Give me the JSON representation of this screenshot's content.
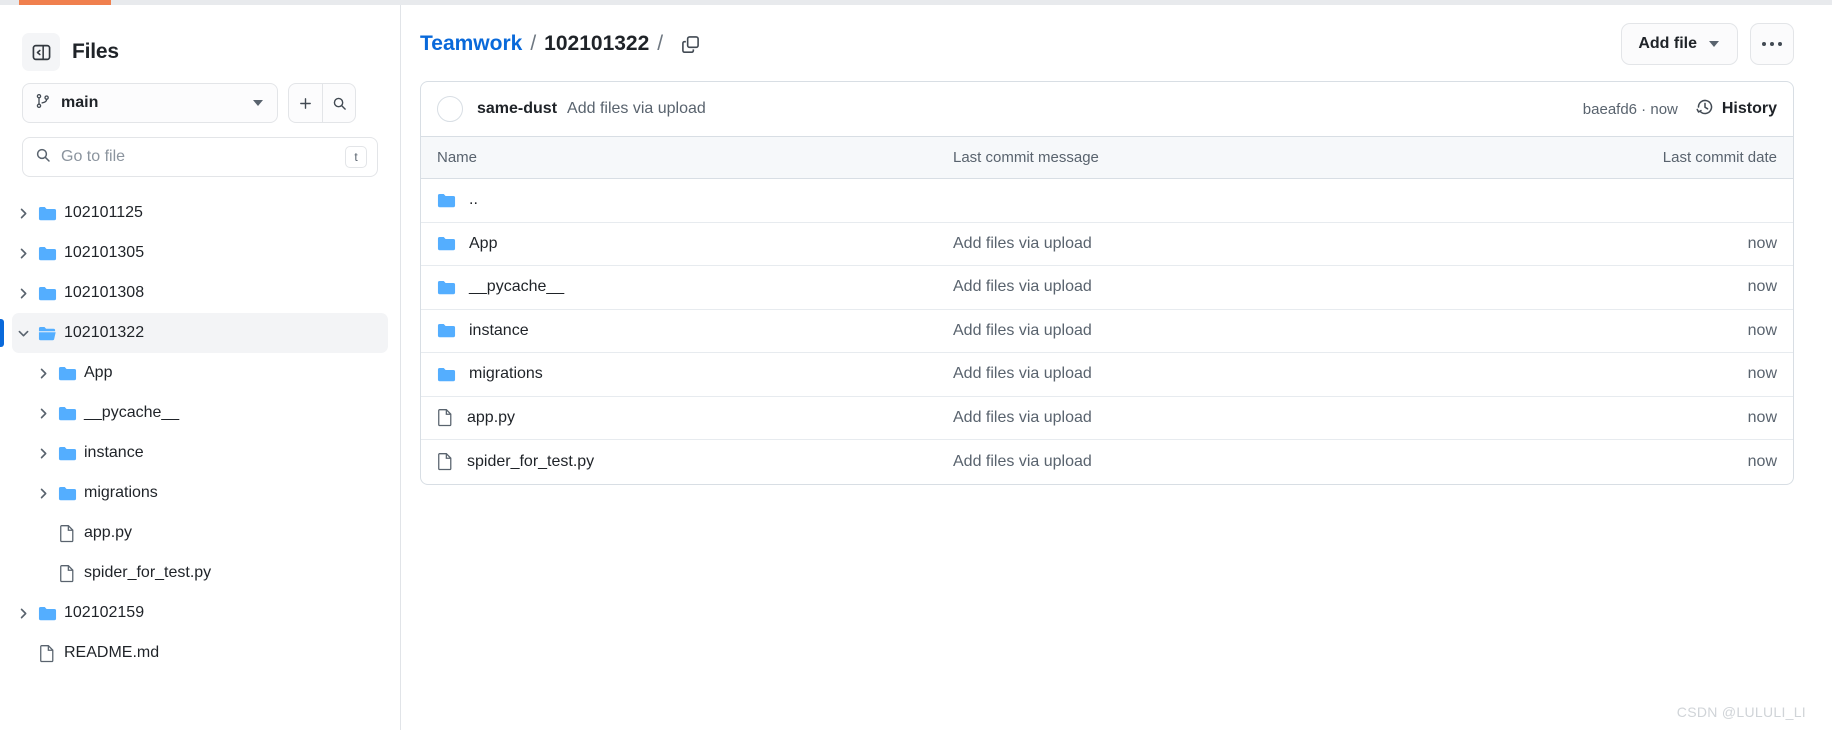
{
  "sidebar": {
    "toggle_icon": "sidebar-collapse-icon",
    "title": "Files",
    "branch": {
      "icon": "git-branch-icon",
      "name": "main",
      "caret_icon": "chevron-down-icon"
    },
    "add_button_icon": "plus-icon",
    "search_button_icon": "search-icon",
    "file_search": {
      "icon": "search-icon",
      "value": "",
      "placeholder": "Go to file",
      "shortcut": "t"
    },
    "tree": [
      {
        "chevron": "chevron-right-icon",
        "icon": "folder-icon",
        "label": "102101125",
        "depth": 0,
        "type": "folder",
        "selected": false,
        "expanded": false
      },
      {
        "chevron": "chevron-right-icon",
        "icon": "folder-icon",
        "label": "102101305",
        "depth": 0,
        "type": "folder",
        "selected": false,
        "expanded": false
      },
      {
        "chevron": "chevron-right-icon",
        "icon": "folder-icon",
        "label": "102101308",
        "depth": 0,
        "type": "folder",
        "selected": false,
        "expanded": false
      },
      {
        "chevron": "chevron-down-icon",
        "icon": "folder-open-icon",
        "label": "102101322",
        "depth": 0,
        "type": "folder",
        "selected": true,
        "expanded": true
      },
      {
        "chevron": "chevron-right-icon",
        "icon": "folder-icon",
        "label": "App",
        "depth": 1,
        "type": "folder",
        "selected": false,
        "expanded": false
      },
      {
        "chevron": "chevron-right-icon",
        "icon": "folder-icon",
        "label": "__pycache__",
        "depth": 1,
        "type": "folder",
        "selected": false,
        "expanded": false
      },
      {
        "chevron": "chevron-right-icon",
        "icon": "folder-icon",
        "label": "instance",
        "depth": 1,
        "type": "folder",
        "selected": false,
        "expanded": false
      },
      {
        "chevron": "chevron-right-icon",
        "icon": "folder-icon",
        "label": "migrations",
        "depth": 1,
        "type": "folder",
        "selected": false,
        "expanded": false
      },
      {
        "chevron": "",
        "icon": "file-icon",
        "label": "app.py",
        "depth": 1,
        "type": "file",
        "selected": false,
        "expanded": false
      },
      {
        "chevron": "",
        "icon": "file-icon",
        "label": "spider_for_test.py",
        "depth": 1,
        "type": "file",
        "selected": false,
        "expanded": false
      },
      {
        "chevron": "chevron-right-icon",
        "icon": "folder-icon",
        "label": "102102159",
        "depth": 0,
        "type": "folder",
        "selected": false,
        "expanded": false
      },
      {
        "chevron": "",
        "icon": "file-icon",
        "label": "README.md",
        "depth": 0,
        "type": "file",
        "selected": false,
        "expanded": false
      }
    ]
  },
  "header": {
    "breadcrumb": {
      "repo": "Teamwork",
      "sep1": "/",
      "current": "102101322",
      "sep2": "/",
      "copy_icon": "copy-path-icon"
    },
    "add_file_label": "Add file",
    "add_file_caret_icon": "chevron-down-icon",
    "more_button_icon": "kebab-menu-icon"
  },
  "commit_bar": {
    "avatar_icon": "avatar",
    "author": "same-dust",
    "message": "Add files via upload",
    "sha_and_time": "baeafd6 · now",
    "history_icon": "history-clock-icon",
    "history_label": "History"
  },
  "file_table": {
    "columns": {
      "name": "Name",
      "message": "Last commit message",
      "date": "Last commit date"
    },
    "rows": [
      {
        "icon": "folder-icon",
        "name": "..",
        "message": "",
        "date": "",
        "type": "folder"
      },
      {
        "icon": "folder-icon",
        "name": "App",
        "message": "Add files via upload",
        "date": "now",
        "type": "folder"
      },
      {
        "icon": "folder-icon",
        "name": "__pycache__",
        "message": "Add files via upload",
        "date": "now",
        "type": "folder"
      },
      {
        "icon": "folder-icon",
        "name": "instance",
        "message": "Add files via upload",
        "date": "now",
        "type": "folder"
      },
      {
        "icon": "folder-icon",
        "name": "migrations",
        "message": "Add files via upload",
        "date": "now",
        "type": "folder"
      },
      {
        "icon": "file-icon",
        "name": "app.py",
        "message": "Add files via upload",
        "date": "now",
        "type": "file"
      },
      {
        "icon": "file-icon",
        "name": "spider_for_test.py",
        "message": "Add files via upload",
        "date": "now",
        "type": "file"
      }
    ]
  },
  "watermark": "CSDN @LULULI_LI",
  "colors": {
    "accent_orange": "#f0804e",
    "link_blue": "#0969da",
    "folder_blue": "#54aeff",
    "selected_bar": "#0969da",
    "border": "#d8dee4",
    "muted_text": "#59636e"
  }
}
